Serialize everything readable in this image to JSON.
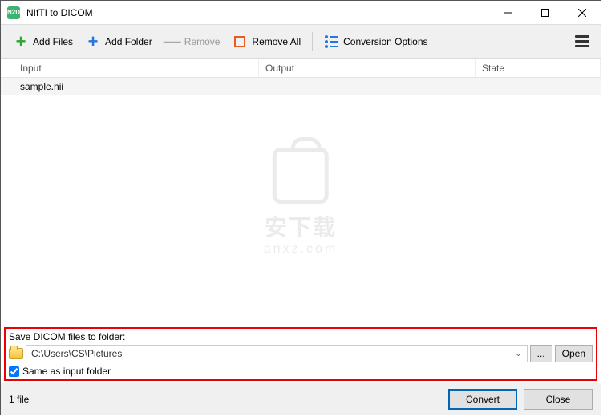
{
  "window": {
    "title": "NIfTI to DICOM",
    "app_icon_text": "N2D"
  },
  "toolbar": {
    "add_files": "Add Files",
    "add_folder": "Add Folder",
    "remove": "Remove",
    "remove_all": "Remove All",
    "options": "Conversion Options"
  },
  "table": {
    "headers": {
      "input": "Input",
      "output": "Output",
      "state": "State"
    },
    "rows": [
      {
        "input": "sample.nii",
        "output": "",
        "state": ""
      }
    ]
  },
  "watermark": {
    "name": "安下载",
    "url": "anxz.com"
  },
  "save": {
    "label": "Save DICOM files to folder:",
    "path": "C:\\Users\\CS\\Pictures",
    "browse": "...",
    "open": "Open",
    "same_checkbox": "Same as input folder",
    "same_checked": true
  },
  "footer": {
    "file_count": "1 file",
    "convert": "Convert",
    "close": "Close"
  }
}
